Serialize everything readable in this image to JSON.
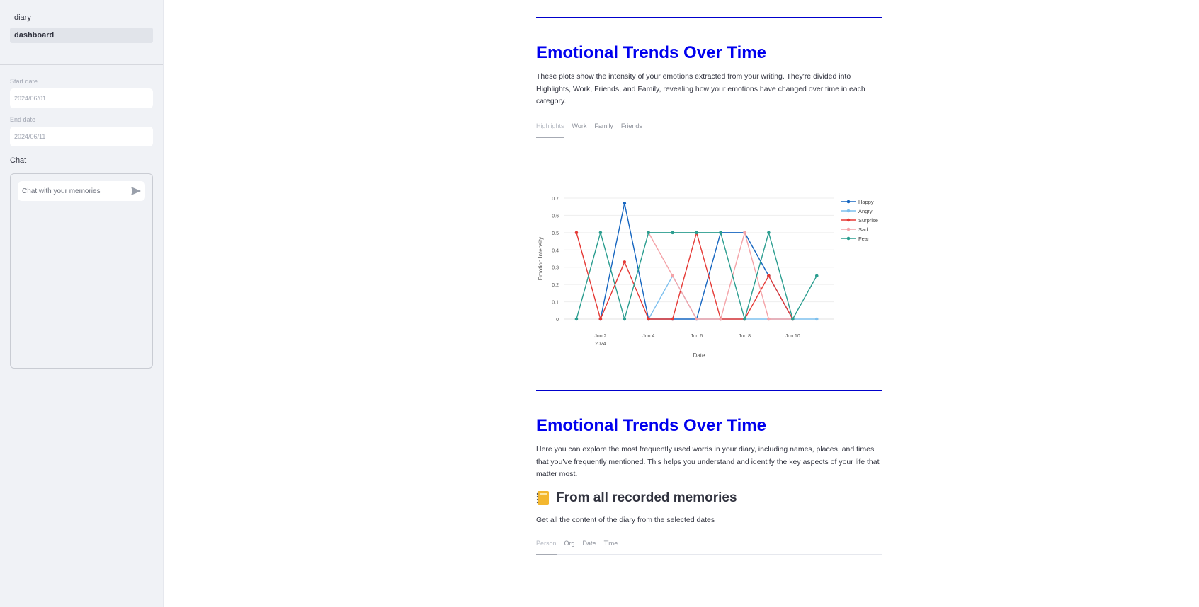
{
  "sidebar": {
    "nav": [
      {
        "label": "diary",
        "active": false
      },
      {
        "label": "dashboard",
        "active": true
      }
    ],
    "start_date": {
      "label": "Start date",
      "value": "2024/06/01"
    },
    "end_date": {
      "label": "End date",
      "value": "2024/06/11"
    },
    "chat": {
      "label": "Chat",
      "placeholder": "Chat with your memories",
      "send_icon": "send-icon"
    }
  },
  "section1": {
    "title": "Emotional Trends Over Time",
    "description": "These plots show the intensity of your emotions extracted from your writing. They're divided into Highlights, Work, Friends, and Family, revealing how your emotions have changed over time in each category.",
    "tabs": [
      "Highlights",
      "Work",
      "Family",
      "Friends"
    ],
    "active_tab": "Highlights"
  },
  "chart_data": {
    "type": "line",
    "title": "",
    "xlabel": "Date",
    "ylabel": "Emotion Intensity",
    "x": [
      "2024-06-01",
      "2024-06-02",
      "2024-06-03",
      "2024-06-04",
      "2024-06-05",
      "2024-06-06",
      "2024-06-07",
      "2024-06-08",
      "2024-06-09",
      "2024-06-10",
      "2024-06-11"
    ],
    "x_ticks": [
      {
        "date": "2024-06-02",
        "label": "Jun 2",
        "sub": "2024"
      },
      {
        "date": "2024-06-04",
        "label": "Jun 4",
        "sub": ""
      },
      {
        "date": "2024-06-06",
        "label": "Jun 6",
        "sub": ""
      },
      {
        "date": "2024-06-08",
        "label": "Jun 8",
        "sub": ""
      },
      {
        "date": "2024-06-10",
        "label": "Jun 10",
        "sub": ""
      }
    ],
    "ylim": [
      0,
      0.7
    ],
    "y_ticks": [
      0,
      0.1,
      0.2,
      0.3,
      0.4,
      0.5,
      0.6,
      0.7
    ],
    "grid": true,
    "legend": "top-right",
    "series": [
      {
        "name": "Happy",
        "color": "#1565c0",
        "values": [
          null,
          0,
          0.67,
          0,
          0,
          0,
          0.5,
          0.5,
          0.25,
          0,
          null
        ]
      },
      {
        "name": "Angry",
        "color": "#7ec0ee",
        "values": [
          null,
          null,
          null,
          0,
          0.25,
          0,
          0,
          0,
          0,
          0,
          0
        ]
      },
      {
        "name": "Surprise",
        "color": "#e53935",
        "values": [
          0.5,
          0,
          0.33,
          0,
          0,
          0.5,
          0,
          0,
          0.25,
          0,
          null
        ]
      },
      {
        "name": "Sad",
        "color": "#f4a3a8",
        "values": [
          null,
          null,
          null,
          0.5,
          0.25,
          0,
          0,
          0.5,
          0,
          0,
          null
        ]
      },
      {
        "name": "Fear",
        "color": "#2a9d8f",
        "values": [
          0,
          0.5,
          0,
          0.5,
          0.5,
          0.5,
          0.5,
          0,
          0.5,
          0,
          0.25
        ]
      }
    ]
  },
  "section2": {
    "title": "Emotional Trends Over Time",
    "description": "Here you can explore the most frequently used words in your diary, including names, places, and times that you've frequently mentioned. This helps you understand and identify the key aspects of your life that matter most.",
    "subheading": "From all recorded memories",
    "subheading_icon": "notebook-icon",
    "subcaption": "Get all the content of the diary from the selected dates",
    "tabs": [
      "Person",
      "Org",
      "Date",
      "Time"
    ],
    "active_tab": "Person"
  }
}
